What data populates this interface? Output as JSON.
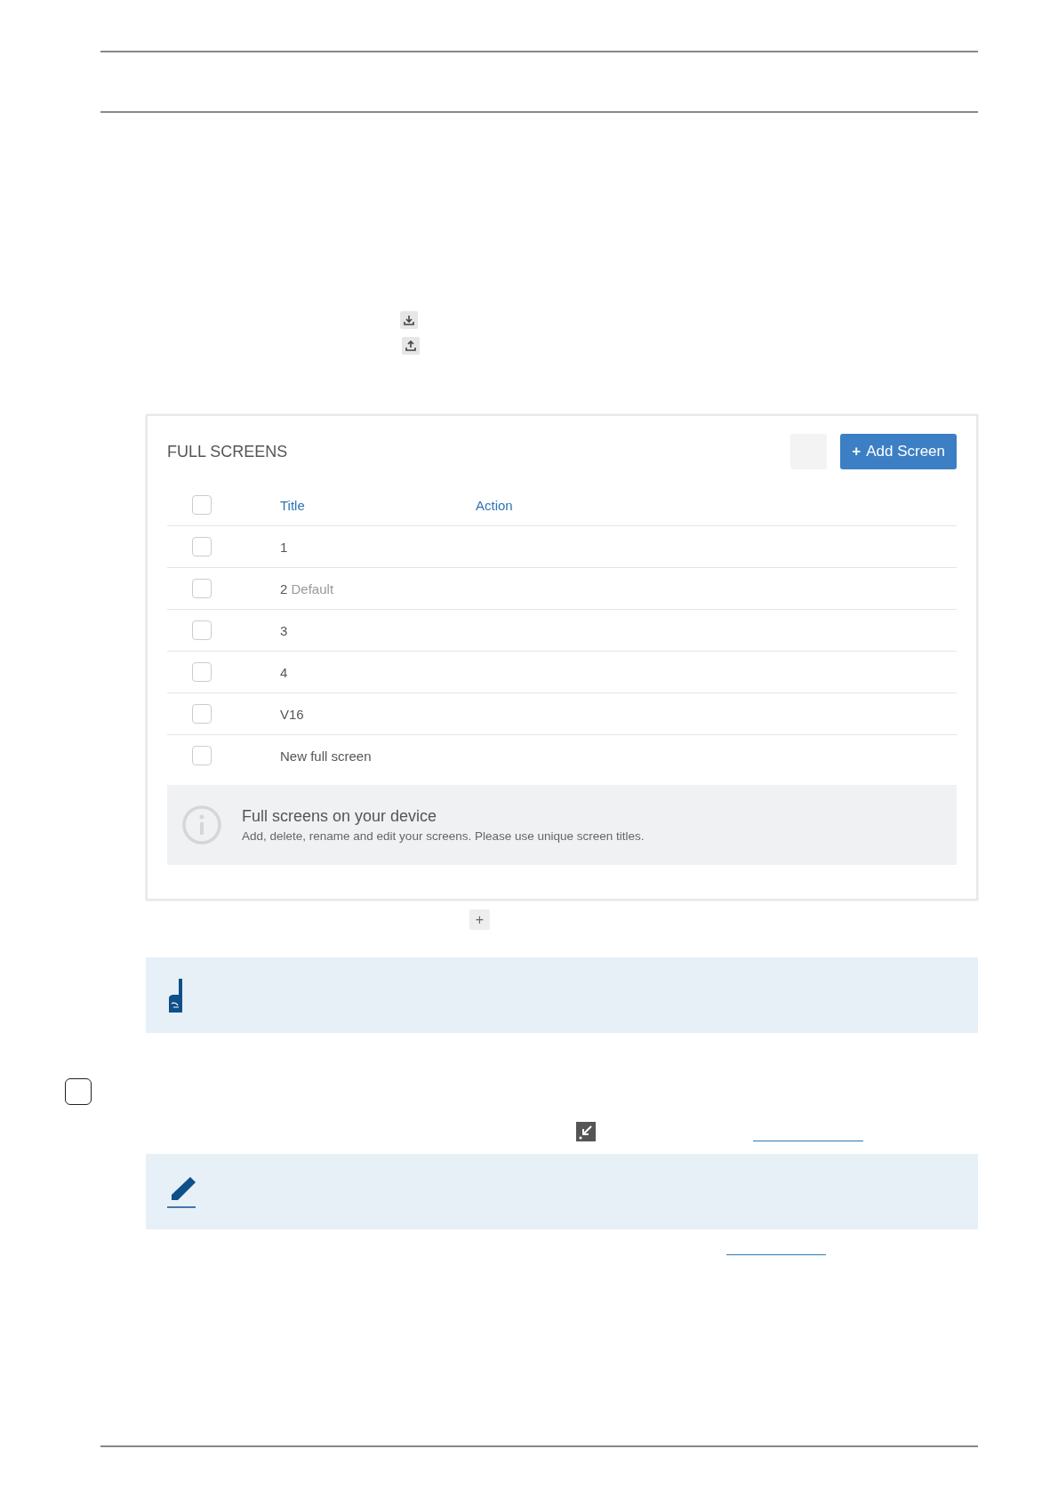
{
  "panel": {
    "title": "FULL SCREENS",
    "add_button": {
      "icon": "+",
      "label": "Add Screen"
    },
    "columns": [
      "Title",
      "Action"
    ],
    "header_checkbox": {
      "checked": false
    },
    "rows": [
      {
        "title": "1",
        "checked": false
      },
      {
        "title": "2",
        "badge": "Default",
        "checked": false
      },
      {
        "title": "3",
        "checked": false
      },
      {
        "title": "4",
        "checked": false
      },
      {
        "title": "V16",
        "checked": false
      },
      {
        "title": "New full screen",
        "checked": false
      }
    ],
    "info": {
      "heading": "Full screens on your device",
      "text": "Add, delete, rename and edit your screens. Please use unique screen titles."
    }
  },
  "below_button": "+",
  "notes": [
    {
      "kind": "tip"
    },
    {
      "kind": "edit"
    }
  ]
}
